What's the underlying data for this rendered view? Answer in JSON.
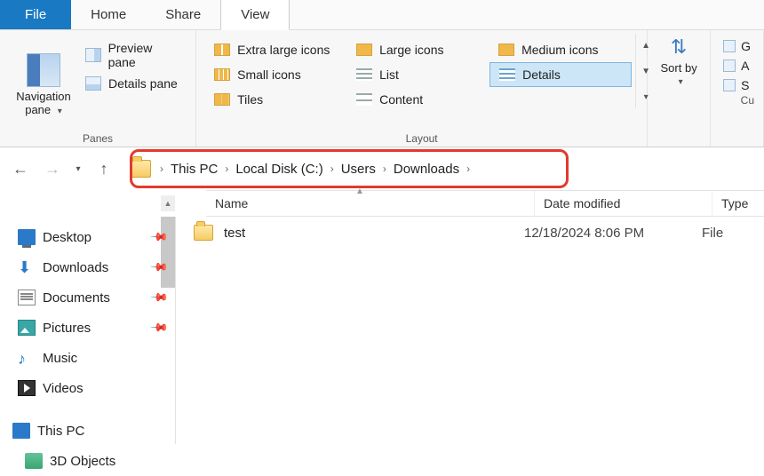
{
  "tabs": {
    "file": "File",
    "home": "Home",
    "share": "Share",
    "view": "View"
  },
  "ribbon": {
    "panes": {
      "navigation": "Navigation pane",
      "preview": "Preview pane",
      "details": "Details pane",
      "group_label": "Panes"
    },
    "layout": {
      "xl": "Extra large icons",
      "lg": "Large icons",
      "md": "Medium icons",
      "sm": "Small icons",
      "list": "List",
      "details": "Details",
      "tiles": "Tiles",
      "content": "Content",
      "group_label": "Layout"
    },
    "sort": {
      "label": "Sort by"
    },
    "right": {
      "g": "G",
      "a": "A",
      "s": "S"
    },
    "cu": "Cu"
  },
  "breadcrumb": [
    "This PC",
    "Local Disk (C:)",
    "Users",
    "Downloads"
  ],
  "columns": {
    "name": "Name",
    "date": "Date modified",
    "type": "Type"
  },
  "tree": {
    "desktop": "Desktop",
    "downloads": "Downloads",
    "documents": "Documents",
    "pictures": "Pictures",
    "music": "Music",
    "videos": "Videos",
    "thispc": "This PC",
    "threeD": "3D Objects"
  },
  "files": [
    {
      "name": "test",
      "date": "12/18/2024 8:06 PM",
      "type": "File"
    }
  ]
}
